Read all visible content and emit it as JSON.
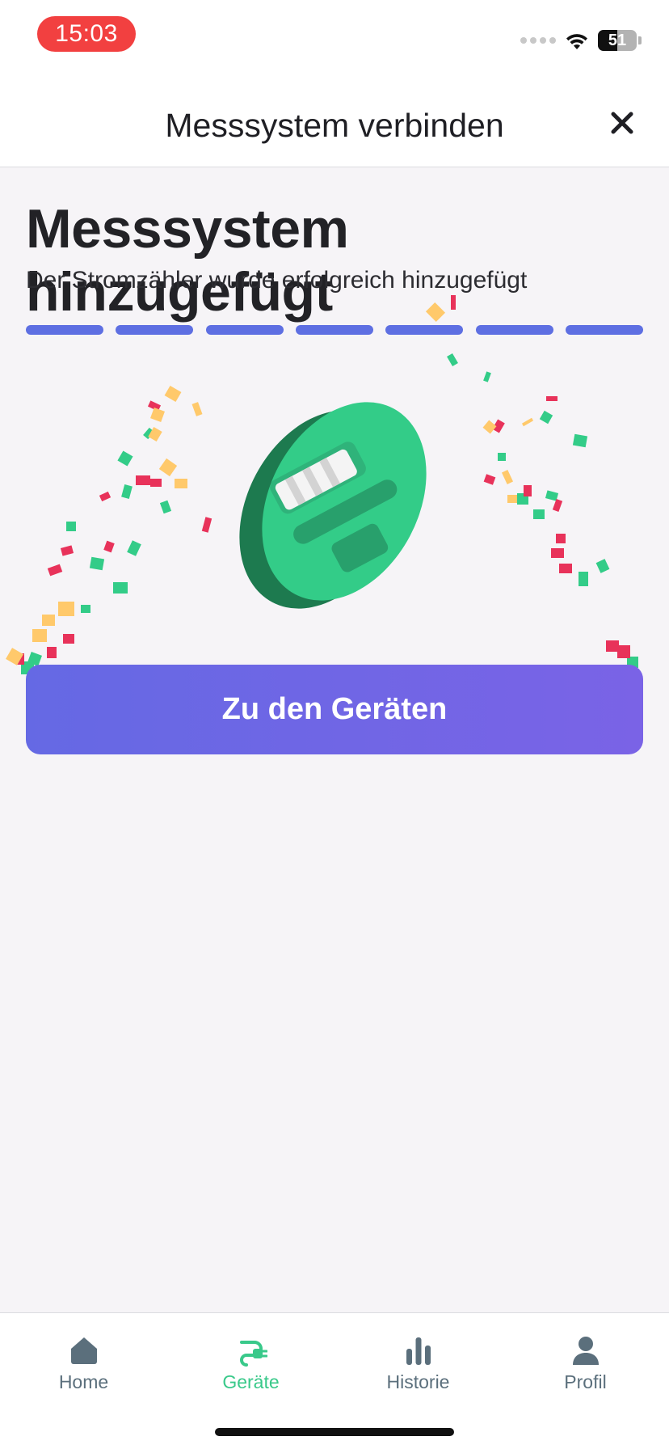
{
  "status_bar": {
    "time": "15:03",
    "battery": "51"
  },
  "header": {
    "title": "Messsystem verbinden",
    "close_icon": "close-icon"
  },
  "content": {
    "title": "Messsystem hinzugefügt",
    "subtitle": "Der Stromzähler wurde erfolgreich hinzugefügt",
    "progress_steps_total": 7,
    "progress_steps_completed": 7,
    "illustration": "electricity-meter-icon",
    "primary_button": "Zu den Geräten"
  },
  "tab_bar": {
    "items": [
      {
        "label": "Home",
        "icon": "home-icon",
        "active": false
      },
      {
        "label": "Geräte",
        "icon": "plug-icon",
        "active": true
      },
      {
        "label": "Historie",
        "icon": "bar-chart-icon",
        "active": false
      },
      {
        "label": "Profil",
        "icon": "person-icon",
        "active": false
      }
    ]
  },
  "colors": {
    "accent": "#5e6fe2",
    "button_start": "#6569e4",
    "button_end": "#7a63e6",
    "active_tab": "#39c98a",
    "inactive_tab": "#5b6f7c",
    "meter_dark": "#1d7a4f",
    "meter_light": "#33cc88",
    "confetti": [
      "#33cc88",
      "#e8325a",
      "#ffc96b"
    ]
  }
}
